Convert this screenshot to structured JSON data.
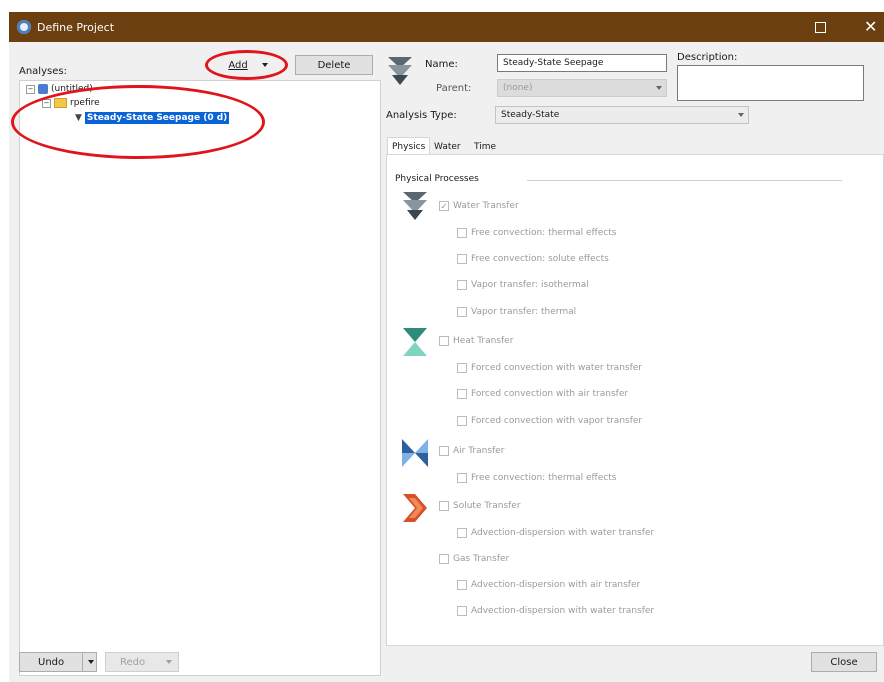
{
  "window": {
    "title": "Define Project",
    "maximize": "□",
    "close": "✕"
  },
  "left": {
    "analyses_label": "Analyses:",
    "add_label": "Add",
    "delete_label": "Delete",
    "tree": {
      "root": "(untitled)",
      "folder": "rpefire",
      "analysis": "Steady-State Seepage (0 d)"
    }
  },
  "right": {
    "name_label": "Name:",
    "name_value": "Steady-State Seepage",
    "parent_label": "Parent:",
    "parent_value": "(none)",
    "analysis_type_label": "Analysis Type:",
    "analysis_type_value": "Steady-State",
    "description_label": "Description:",
    "description_value": "",
    "tabs": [
      "Physics",
      "Water",
      "Time"
    ],
    "active_tab": "Physics",
    "physical_processes_label": "Physical Processes",
    "groups": [
      {
        "label": "Water Transfer",
        "checked": true,
        "icon": "water-transfer-icon",
        "options": [
          "Free convection: thermal effects",
          "Free convection: solute effects",
          "Vapor transfer: isothermal",
          "Vapor transfer: thermal"
        ]
      },
      {
        "label": "Heat Transfer",
        "checked": false,
        "icon": "heat-transfer-icon",
        "options": [
          "Forced convection with water transfer",
          "Forced convection with air transfer",
          "Forced convection with vapor transfer"
        ]
      },
      {
        "label": "Air Transfer",
        "checked": false,
        "icon": "air-transfer-icon",
        "options": [
          "Free convection: thermal effects"
        ]
      },
      {
        "label": "Solute Transfer",
        "checked": false,
        "icon": "solute-transfer-icon",
        "options": [
          "Advection-dispersion with water transfer"
        ]
      },
      {
        "label": "Gas Transfer",
        "checked": false,
        "icon": "",
        "options": [
          "Advection-dispersion with air transfer",
          "Advection-dispersion with water transfer"
        ]
      }
    ]
  },
  "bottom": {
    "undo_label": "Undo",
    "redo_label": "Redo",
    "close_label": "Close"
  },
  "colors": {
    "titlebar": "#6b3f10",
    "selection": "#0a64d8",
    "annotation": "#e0141a"
  }
}
